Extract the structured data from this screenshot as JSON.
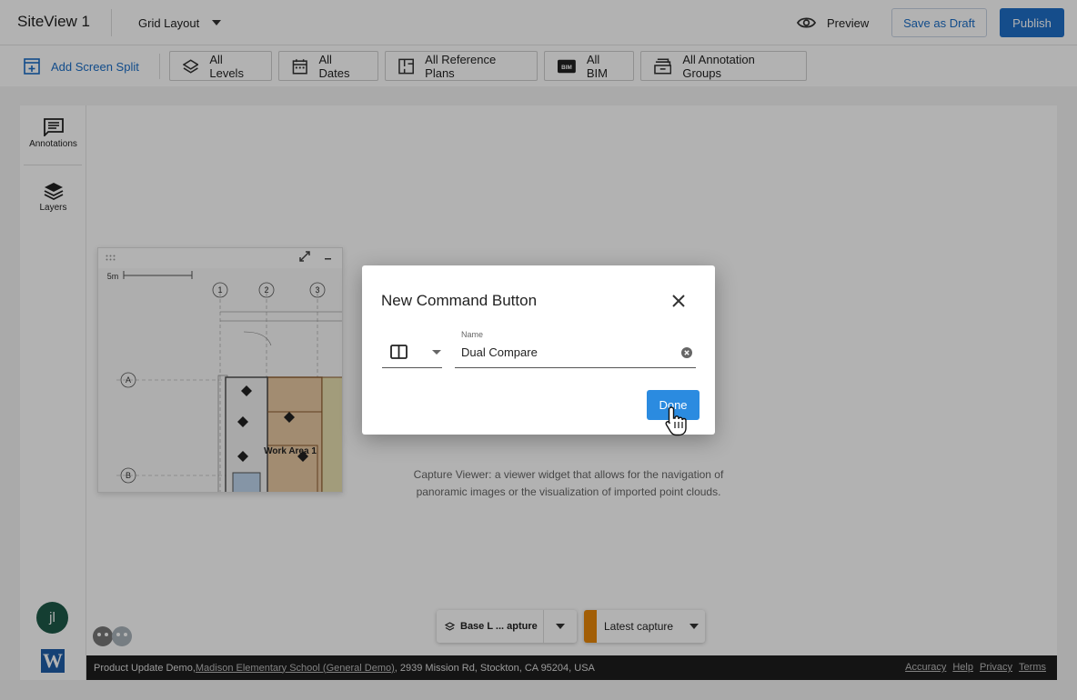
{
  "header": {
    "app_title": "SiteView 1",
    "layout_select": "Grid Layout",
    "preview_label": "Preview",
    "save_draft_label": "Save as Draft",
    "publish_label": "Publish"
  },
  "toolbar": {
    "add_split_label": "Add Screen Split",
    "chips": [
      {
        "label": "All Levels",
        "icon": "layers-icon"
      },
      {
        "label": "All Dates",
        "icon": "calendar-icon"
      },
      {
        "label": "All Reference Plans",
        "icon": "reference-plan-icon"
      },
      {
        "label": "All BIM",
        "icon": "bim-icon"
      },
      {
        "label": "All Annotation Groups",
        "icon": "annotation-groups-icon"
      }
    ]
  },
  "sidebar": {
    "items": [
      {
        "label": "Annotations",
        "icon": "annotations-icon"
      },
      {
        "label": "Layers",
        "icon": "layers-icon"
      }
    ],
    "avatar_initials": "jl",
    "logo_letter": "W"
  },
  "minimap": {
    "scale_label": "5m",
    "grid_columns": [
      "1",
      "2",
      "3"
    ],
    "grid_rows": [
      "A",
      "B"
    ],
    "area_label": "Work Area 1"
  },
  "canvas": {
    "placeholder_text": "Capture Viewer: a viewer widget that allows for the navigation of panoramic images or the visualization of imported point clouds."
  },
  "bottom_controls": {
    "base_layer_label": "Base L ... apture",
    "capture_label": "Latest capture"
  },
  "footer": {
    "prefix": "Product Update Demo, ",
    "project_link": "Madison Elementary School (General Demo)",
    "address": ", 2939 Mission Rd, Stockton, CA 95204, USA",
    "links": [
      "Accuracy",
      "Help",
      "Privacy",
      "Terms"
    ]
  },
  "modal": {
    "title": "New Command Button",
    "name_label": "Name",
    "name_value": "Dual Compare",
    "selected_icon": "split-view-icon",
    "done_label": "Done"
  },
  "colors": {
    "primary": "#1f6fc8",
    "done_button": "#2b8be0",
    "avatar": "#1e5a48",
    "footer_bg": "#1e1e1e"
  }
}
